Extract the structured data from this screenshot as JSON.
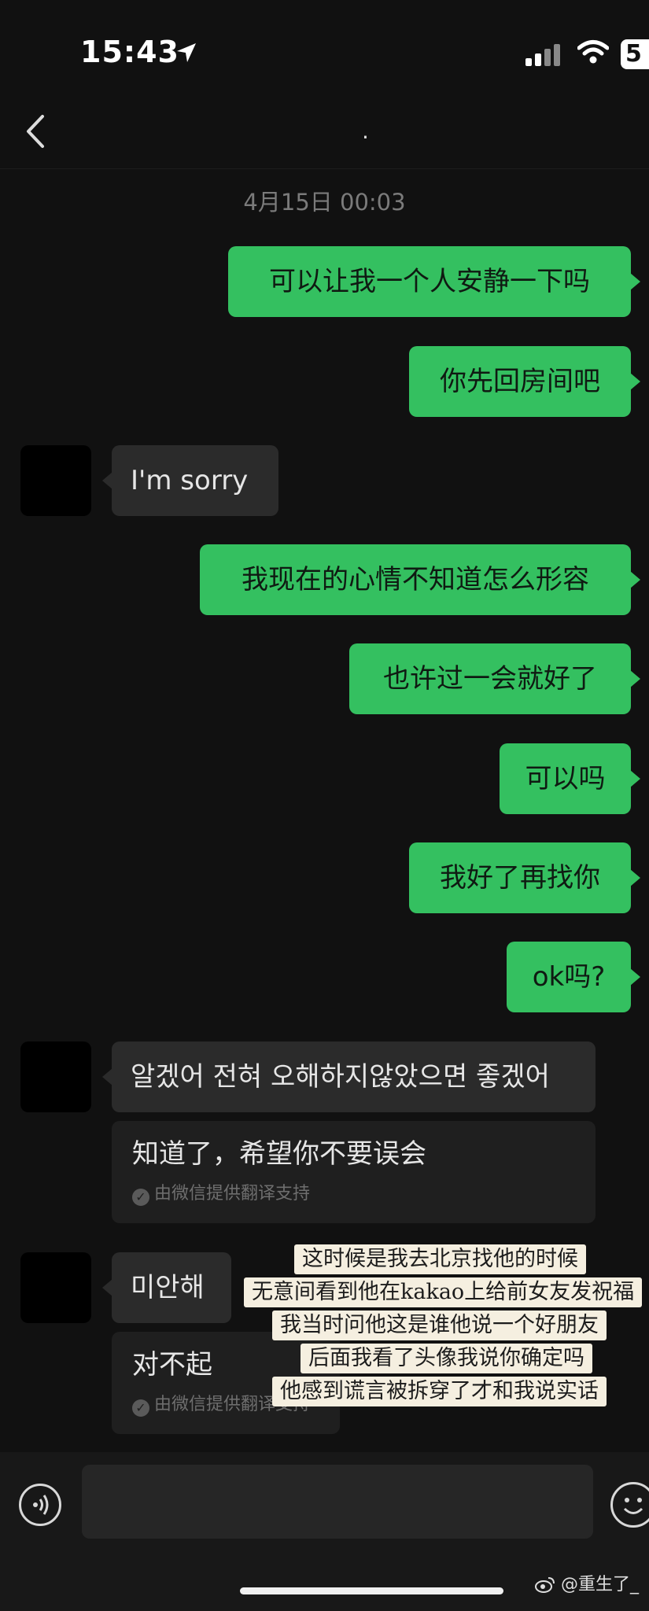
{
  "status_bar": {
    "time": "15:43",
    "battery": "5"
  },
  "header": {
    "title": "."
  },
  "chat": {
    "timestamp": "4月15日 00:03",
    "msg1": "可以让我一个人安静一下吗",
    "msg2": "你先回房间吧",
    "msg3": "I'm sorry",
    "msg4": "我现在的心情不知道怎么形容",
    "msg5": "也许过一会就好了",
    "msg6": "可以吗",
    "msg7": "我好了再找你",
    "msg8": "ok吗?",
    "msg9": "알겠어 전혀 오해하지않았으면 좋겠어",
    "msg9_translation": "知道了，希望你不要误会",
    "msg10": "미안해",
    "msg10_translation": "对不起",
    "translation_note": "由微信提供翻译支持"
  },
  "note": {
    "line1": "这时候是我去北京找他的时候",
    "line2": "无意间看到他在kakao上给前女友发祝福",
    "line3": "我当时问他这是谁他说一个好朋友",
    "line4": "后面我看了头像我说你确定吗",
    "line5": "他感到谎言被拆穿了才和我说实话"
  },
  "watermark": "@重生了_",
  "colors": {
    "outgoing_bubble": "#34c060",
    "incoming_bubble": "#2b2b2b",
    "background": "#111111"
  }
}
